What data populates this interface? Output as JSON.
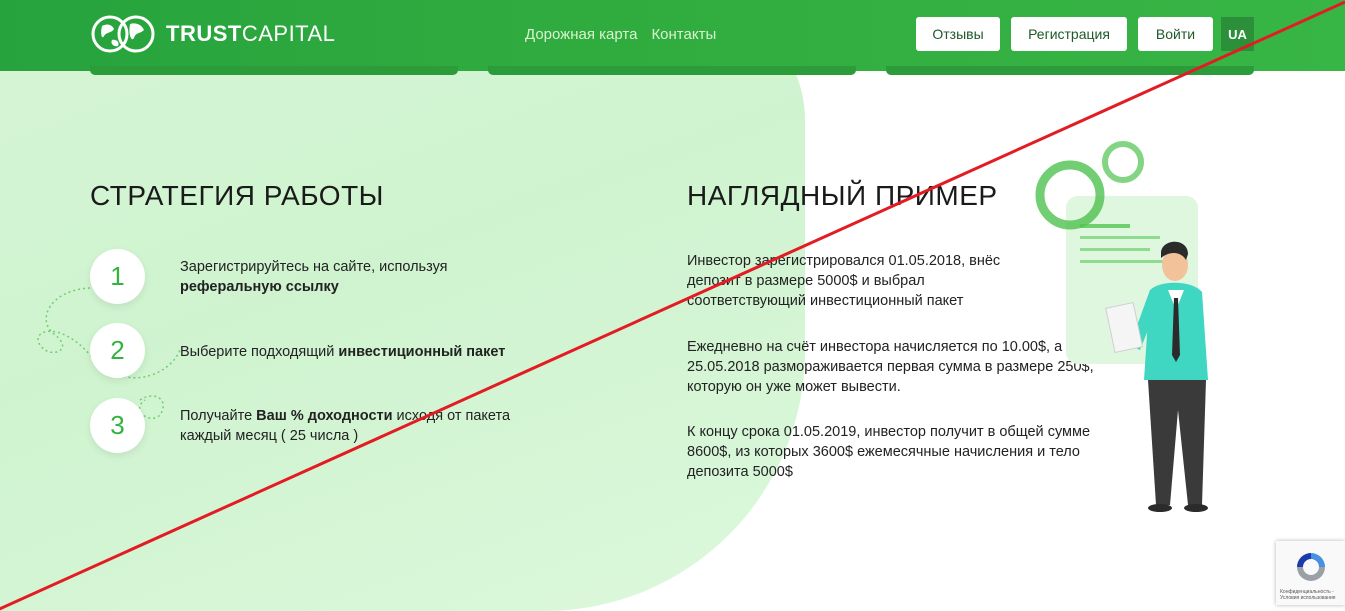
{
  "header": {
    "brand_bold": "TRUST",
    "brand_light": "CAPITAL",
    "nav": [
      "Дорожная карта",
      "Контакты"
    ],
    "buttons": {
      "reviews": "Отзывы",
      "register": "Регистрация",
      "login": "Войти",
      "lang": "UA"
    }
  },
  "strategy": {
    "title": "СТРАТЕГИЯ РАБОТЫ",
    "steps": [
      {
        "num": "1",
        "text_a": "Зарегистрируйтесь на сайте, используя",
        "text_bold": "реферальную ссылку",
        "text_c": ""
      },
      {
        "num": "2",
        "text_a": "Выберите подходящий ",
        "text_bold": "инвестиционный пакет",
        "text_c": ""
      },
      {
        "num": "3",
        "text_a": "Получайте ",
        "text_bold": "Ваш % доходности",
        "text_c": " исходя от пакета каждый месяц ( 25 числа )"
      }
    ]
  },
  "example": {
    "title": "НАГЛЯДНЫЙ ПРИМЕР",
    "paragraphs": [
      "Инвестор зарегистрировался 01.05.2018, внёс депозит в размере 5000$ и выбрал соответствующий инвестиционный пакет",
      "Ежедневно на счёт инвестора начисляется по 10.00$, а 25.05.2018 размораживается первая сумма в размере 250$, которую он уже может вывести.",
      "К концу срока 01.05.2019, инвестор получит в общей сумме 8600$, из которых 3600$ ежемесячные начисления и тело депозита 5000$"
    ]
  },
  "recaptcha": {
    "text": "Конфиденциальность - Условия использования"
  },
  "colors": {
    "brand_green": "#31ad3f",
    "accent_green": "#33b33f",
    "strike_red": "#e31b23"
  }
}
